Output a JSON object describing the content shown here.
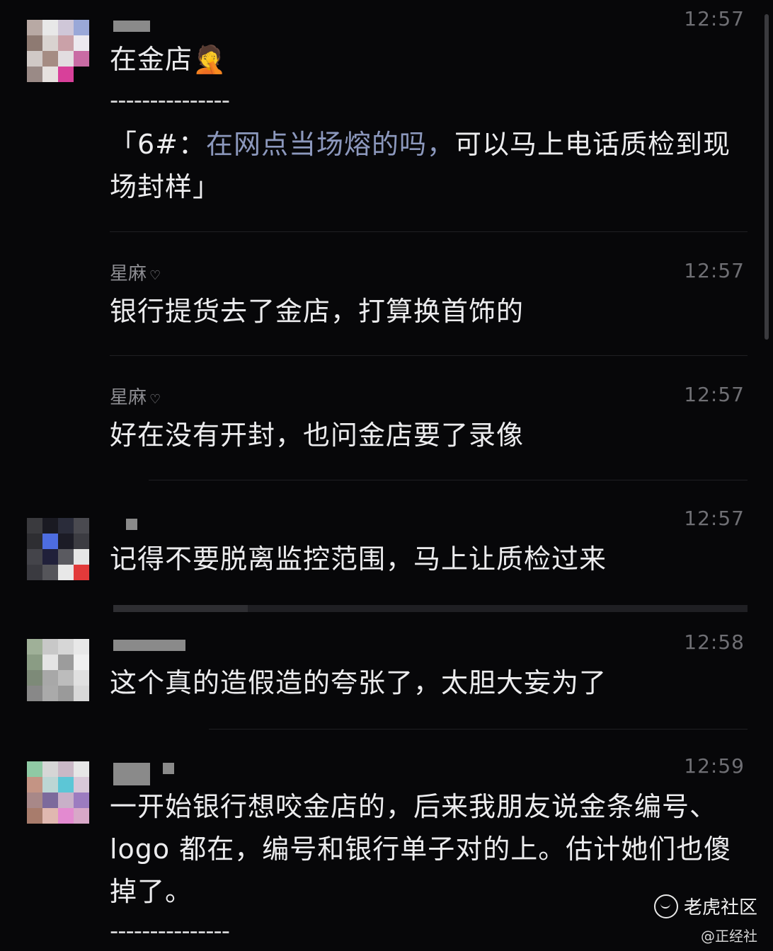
{
  "messages": [
    {
      "time": "12:57",
      "text": "在金店🤦",
      "quote_prefix": "",
      "quote_hl": "",
      "quote_rest": ""
    },
    {
      "time": "",
      "dashes": "---------------",
      "quote_prefix": "「6#：",
      "quote_hl": "在网点当场熔的吗，",
      "quote_rest": "可以马上电话质检到现场封样」"
    },
    {
      "name": "星麻",
      "time": "12:57",
      "text": "银行提货去了金店，打算换首饰的"
    },
    {
      "name": "星麻",
      "time": "12:57",
      "text": "好在没有开封，也问金店要了录像"
    },
    {
      "time": "12:57",
      "text": "记得不要脱离监控范围，马上让质检过来"
    },
    {
      "time": "12:58",
      "text": "这个真的造假造的夸张了，太胆大妄为了"
    },
    {
      "time": "12:59",
      "text": "一开始银行想咬金店的，后来我朋友说金条编号、logo 都在，编号和银行单子对的上。估计她们也傻掉了。",
      "dashes_after": "---------------"
    }
  ],
  "watermark": {
    "main": "老虎社区",
    "sub": "@正经社"
  },
  "colors": {
    "background": "#070709",
    "text": "#ececee",
    "time": "#6f6f74",
    "quote_highlight": "#8c98bd"
  }
}
